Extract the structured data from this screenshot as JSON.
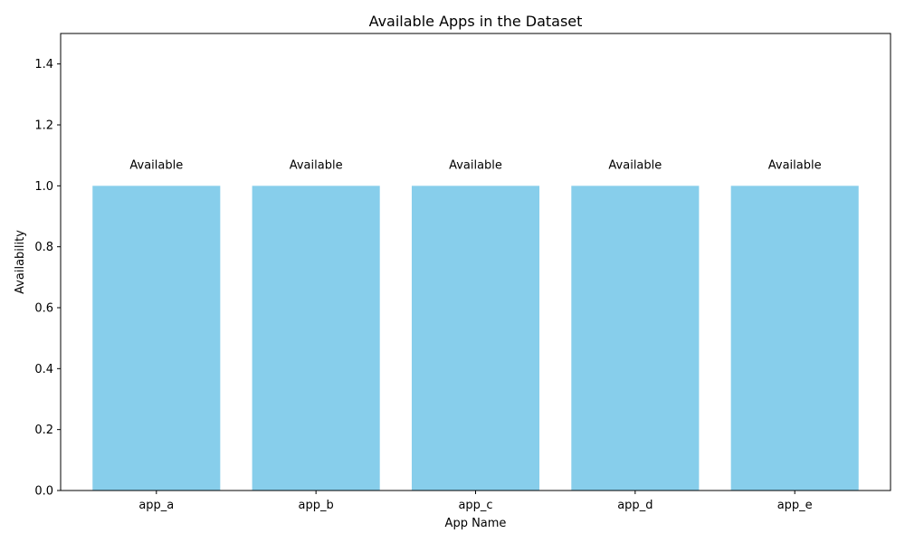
{
  "chart_data": {
    "type": "bar",
    "title": "Available Apps in the Dataset",
    "xlabel": "App Name",
    "ylabel": "Availability",
    "categories": [
      "app_a",
      "app_b",
      "app_c",
      "app_d",
      "app_e"
    ],
    "values": [
      1,
      1,
      1,
      1,
      1
    ],
    "data_labels": [
      "Available",
      "Available",
      "Available",
      "Available",
      "Available"
    ],
    "ylim": [
      0,
      1.5
    ],
    "yticks": [
      0.0,
      0.2,
      0.4,
      0.6,
      0.8,
      1.0,
      1.2,
      1.4
    ],
    "ytick_labels": [
      "0.0",
      "0.2",
      "0.4",
      "0.6",
      "0.8",
      "1.0",
      "1.2",
      "1.4"
    ],
    "grid": false,
    "bar_color": "#87CEEB"
  }
}
